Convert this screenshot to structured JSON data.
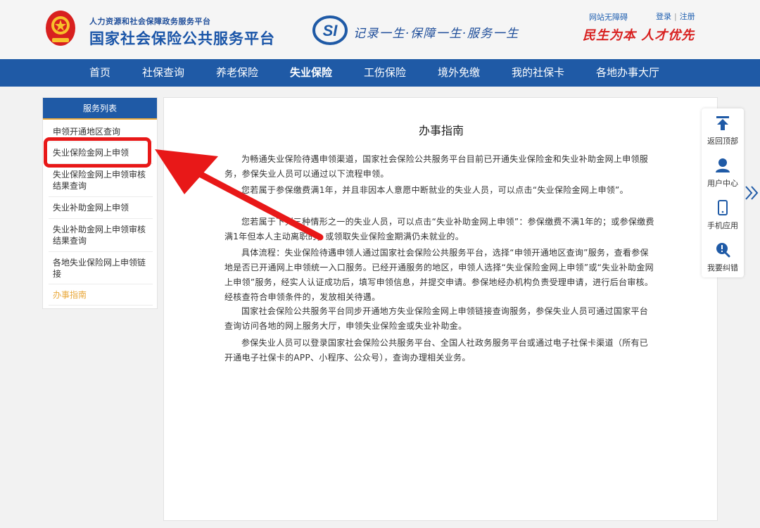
{
  "header": {
    "sub_title": "人力资源和社会保障政务服务平台",
    "main_title": "国家社会保险公共服务平台",
    "si_logo_text": "SI",
    "slogan": "记录一生·保障一生·服务一生",
    "accessible_link": "网站无障碍",
    "login": "登录",
    "register": "注册",
    "motto": "民生为本 人才优先"
  },
  "nav": {
    "items": [
      {
        "label": "首页"
      },
      {
        "label": "社保查询"
      },
      {
        "label": "养老保险"
      },
      {
        "label": "失业保险",
        "active": true
      },
      {
        "label": "工伤保险"
      },
      {
        "label": "境外免缴"
      },
      {
        "label": "我的社保卡"
      },
      {
        "label": "各地办事大厅"
      }
    ]
  },
  "sidebar": {
    "title": "服务列表",
    "items": [
      {
        "label": "申领开通地区查询"
      },
      {
        "label": "失业保险金网上申领"
      },
      {
        "label": "失业保险金网上申领审核结果查询"
      },
      {
        "label": "失业补助金网上申领"
      },
      {
        "label": "失业补助金网上申领审核结果查询"
      },
      {
        "label": "各地失业保险网上申领链接"
      },
      {
        "label": "办事指南",
        "current": true
      }
    ]
  },
  "content": {
    "title": "办事指南",
    "paragraphs": [
      "为畅通失业保险待遇申领渠道，国家社会保险公共服务平台目前已开通失业保险金和失业补助金网上申领服务，参保失业人员可以通过以下流程申领。",
      "您若属于参保缴费满1年，并且非因本人意愿中断就业的失业人员，可以点击“失业保险金网上申领”。",
      "您若属于下列三种情形之一的失业人员，可以点击“失业补助金网上申领”：参保缴费不满1年的；或参保缴费满1年但本人主动离职的；或领取失业保险金期满仍未就业的。",
      "具体流程：失业保险待遇申领人通过国家社会保险公共服务平台，选择“申领开通地区查询”服务，查看参保地是否已开通网上申领统一入口服务。已经开通服务的地区，申领人选择“失业保险金网上申领”或“失业补助金网上申领”服务，经实人认证成功后，填写申领信息，并提交申请。参保地经办机构负责受理申请，进行后台审核。经核查符合申领条件的，发放相关待遇。",
      "国家社会保险公共服务平台同步开通地方失业保险金网上申领链接查询服务，参保失业人员可通过国家平台查询访问各地的网上服务大厅，申领失业保险金或失业补助金。",
      "参保失业人员可以登录国家社会保险公共服务平台、全国人社政务服务平台或通过电子社保卡渠道（所有已开通电子社保卡的APP、小程序、公众号），查询办理相关业务。"
    ]
  },
  "float_bar": {
    "items": [
      {
        "label": "返回顶部",
        "icon": "arrow-up-icon"
      },
      {
        "label": "用户中心",
        "icon": "user-icon"
      },
      {
        "label": "手机应用",
        "icon": "mobile-icon"
      },
      {
        "label": "我要纠错",
        "icon": "feedback-icon"
      }
    ]
  },
  "colors": {
    "brand_blue": "#1f5aa6",
    "accent_orange": "#e9a83b",
    "highlight_red": "#e81818"
  }
}
